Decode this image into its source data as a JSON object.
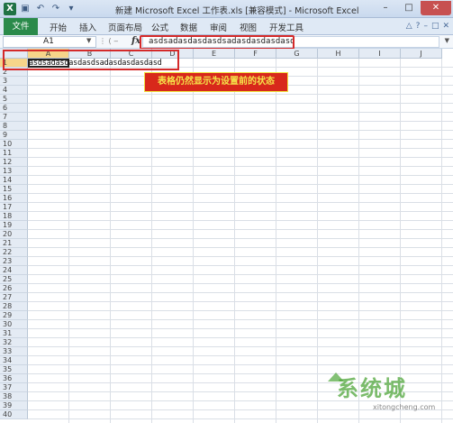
{
  "titlebar": {
    "title": "新建 Microsoft Excel 工作表.xls  [兼容模式]  -  Microsoft Excel",
    "icons": [
      "excel-app-icon",
      "save-icon",
      "undo-icon",
      "redo-icon",
      "customize-icon"
    ],
    "controls": {
      "minimize": "–",
      "maximize": "□",
      "close": "✕"
    }
  },
  "ribbon": {
    "file": "文件",
    "tabs": [
      "开始",
      "插入",
      "页面布局",
      "公式",
      "数据",
      "审阅",
      "视图",
      "开发工具"
    ],
    "right_icons": [
      "△",
      "?",
      "–",
      "□",
      "✕"
    ]
  },
  "formula_bar": {
    "cell_ref": "A1",
    "fx": "fx",
    "content": "asdsadasdasdasdsadasdasdasdasd"
  },
  "grid": {
    "columns": [
      "A",
      "B",
      "C",
      "D",
      "E",
      "F",
      "G",
      "H",
      "I",
      "J"
    ],
    "rows": [
      "1",
      "2",
      "3",
      "4",
      "5",
      "6",
      "7",
      "8",
      "9",
      "10",
      "11",
      "12",
      "13",
      "14",
      "15",
      "16",
      "17",
      "18",
      "19",
      "20",
      "21",
      "22",
      "23",
      "24",
      "25",
      "26",
      "27",
      "28",
      "29",
      "30",
      "31",
      "32",
      "33",
      "34",
      "35",
      "36",
      "37",
      "38",
      "39",
      "40"
    ],
    "a1_value": "asdsadasdasdasdsadasdasdasdasd",
    "active_cell": "A1"
  },
  "callout": {
    "text": "表格仍然显示为设置前的状态"
  },
  "watermark": {
    "brand": "系统城",
    "url": "xitongcheng.com"
  },
  "colors": {
    "file_tab": "#2a8a4a",
    "highlight": "#d42a2a",
    "callout_bg": "#d8281b",
    "callout_text": "#f5e44a"
  }
}
